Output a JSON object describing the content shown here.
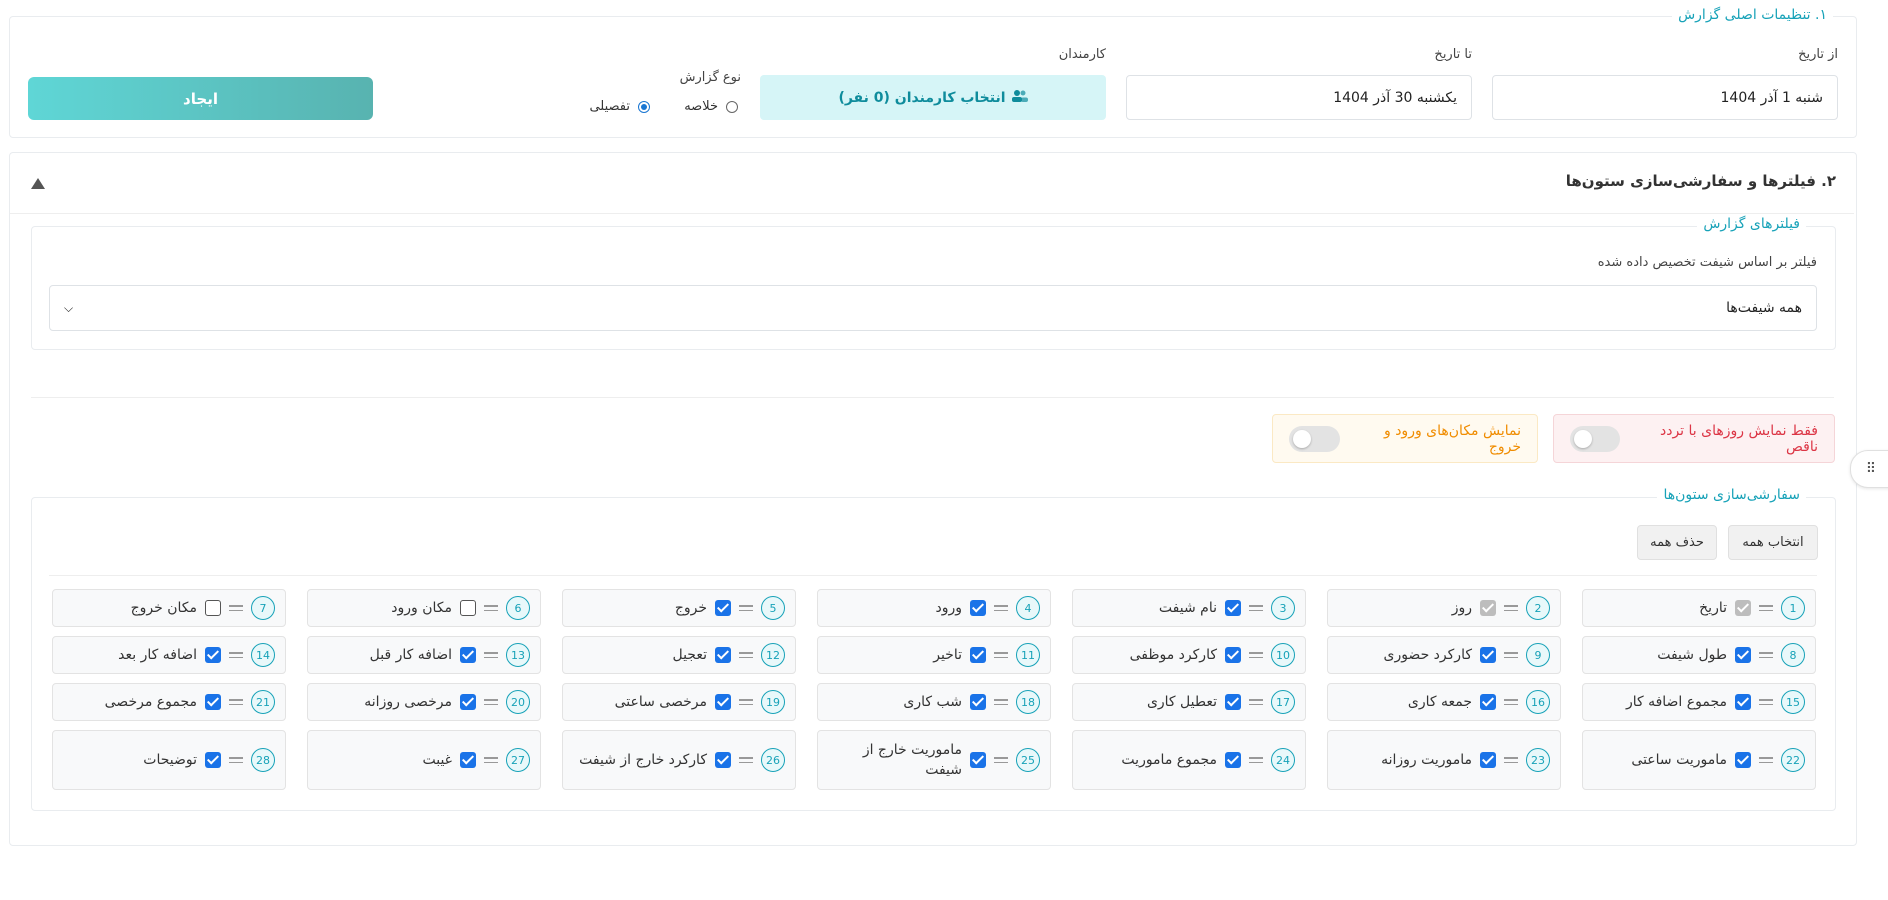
{
  "section1": {
    "legend": "۱. تنظیمات اصلی گزارش",
    "from_label": "از تاریخ",
    "from_value": "شنبه 1 آذر 1404",
    "to_label": "تا تاریخ",
    "to_value": "یکشنبه 30 آذر 1404",
    "employees_label": "کارمندان",
    "employees_button": "انتخاب کارمندان (0 نفر)",
    "report_type_label": "نوع گزارش",
    "opt_summary": "خلاصه",
    "opt_detailed": "تفصیلی",
    "selected_type": "detailed",
    "create_button": "ایجاد"
  },
  "section2": {
    "title": "۲. فیلترها و سفارشی‌سازی ستون‌ها",
    "filters_legend": "فیلترهای گزارش",
    "shift_filter_label": "فیلتر بر اساس شیفت تخصیص داده شده",
    "shift_filter_value": "همه شیفت‌ها",
    "toggle_incomplete": "فقط نمایش روزهای با تردد ناقص",
    "toggle_locations": "نمایش مکان‌های ورود و خروج",
    "columns_legend": "سفارشی‌سازی ستون‌ها",
    "select_all": "انتخاب همه",
    "deselect_all": "حذف همه"
  },
  "columns": [
    {
      "n": "1",
      "label": "تاریخ",
      "state": "disabled"
    },
    {
      "n": "2",
      "label": "روز",
      "state": "disabled"
    },
    {
      "n": "3",
      "label": "نام شیفت",
      "state": "checked"
    },
    {
      "n": "4",
      "label": "ورود",
      "state": "checked"
    },
    {
      "n": "5",
      "label": "خروج",
      "state": "checked"
    },
    {
      "n": "6",
      "label": "مکان ورود",
      "state": "unchecked"
    },
    {
      "n": "7",
      "label": "مکان خروج",
      "state": "unchecked"
    },
    {
      "n": "8",
      "label": "طول شیفت",
      "state": "checked"
    },
    {
      "n": "9",
      "label": "کارکرد حضوری",
      "state": "checked"
    },
    {
      "n": "10",
      "label": "کارکرد موظفی",
      "state": "checked"
    },
    {
      "n": "11",
      "label": "تاخیر",
      "state": "checked"
    },
    {
      "n": "12",
      "label": "تعجیل",
      "state": "checked"
    },
    {
      "n": "13",
      "label": "اضافه کار قبل",
      "state": "checked"
    },
    {
      "n": "14",
      "label": "اضافه کار بعد",
      "state": "checked"
    },
    {
      "n": "15",
      "label": "مجموع اضافه کار",
      "state": "checked"
    },
    {
      "n": "16",
      "label": "جمعه کاری",
      "state": "checked"
    },
    {
      "n": "17",
      "label": "تعطیل کاری",
      "state": "checked"
    },
    {
      "n": "18",
      "label": "شب کاری",
      "state": "checked"
    },
    {
      "n": "19",
      "label": "مرخصی ساعتی",
      "state": "checked"
    },
    {
      "n": "20",
      "label": "مرخصی روزانه",
      "state": "checked"
    },
    {
      "n": "21",
      "label": "مجموع مرخصی",
      "state": "checked"
    },
    {
      "n": "22",
      "label": "ماموریت ساعتی",
      "state": "checked"
    },
    {
      "n": "23",
      "label": "ماموریت روزانه",
      "state": "checked"
    },
    {
      "n": "24",
      "label": "مجموع ماموریت",
      "state": "checked"
    },
    {
      "n": "25",
      "label": "ماموریت خارج از شیفت",
      "state": "checked"
    },
    {
      "n": "26",
      "label": "کارکرد خارج از شیفت",
      "state": "checked"
    },
    {
      "n": "27",
      "label": "غیبت",
      "state": "checked"
    },
    {
      "n": "28",
      "label": "توضیحات",
      "state": "checked"
    }
  ]
}
